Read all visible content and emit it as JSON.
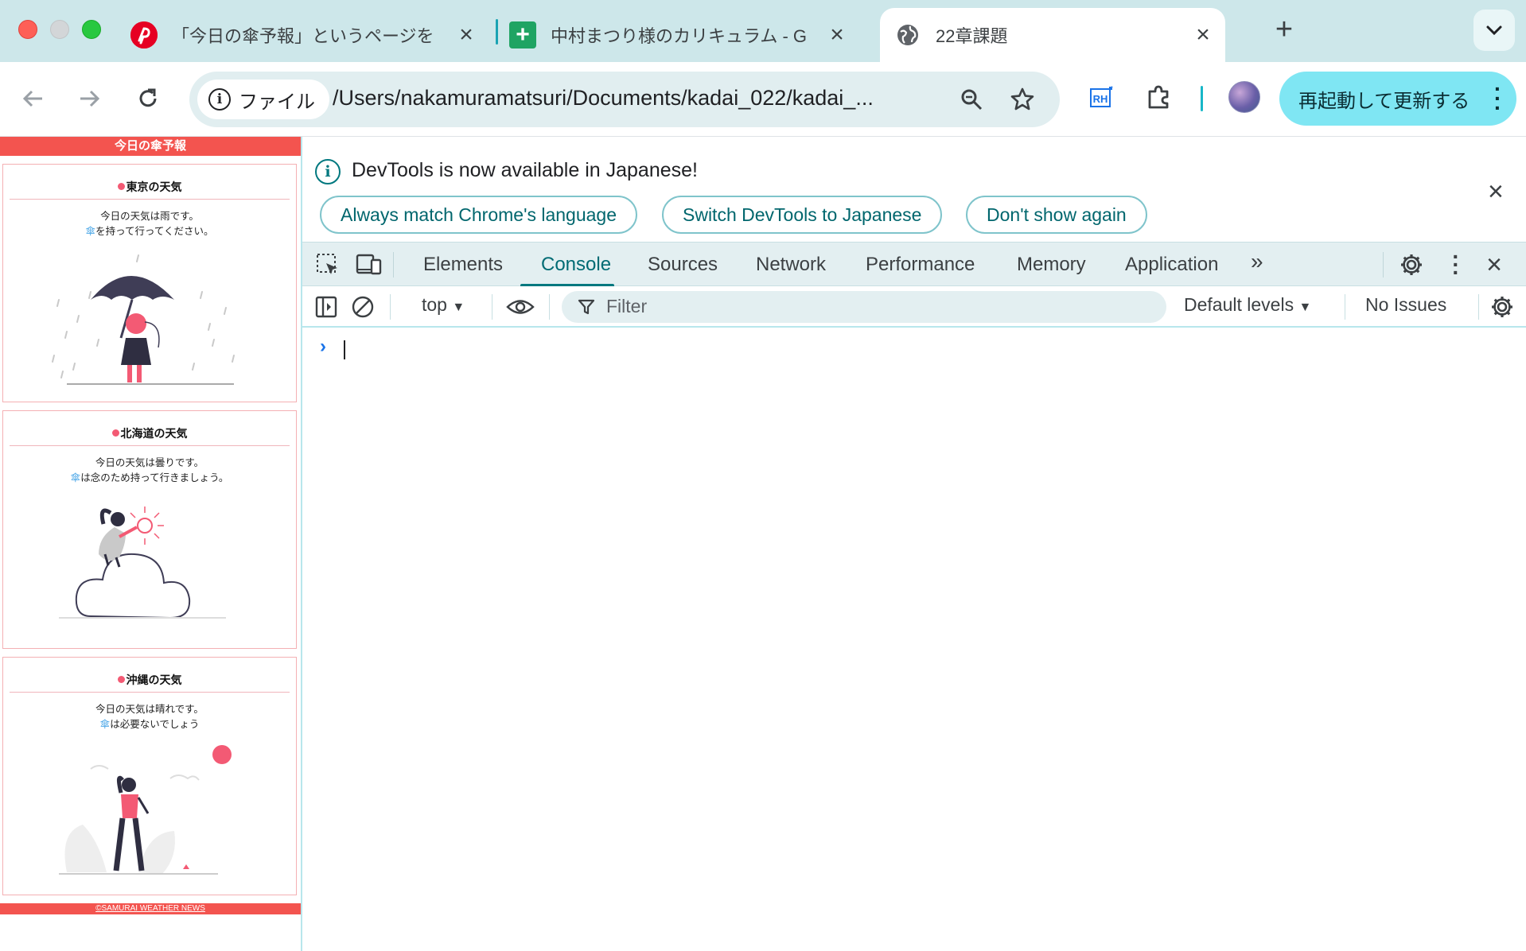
{
  "browser": {
    "tabs": [
      {
        "title": "「今日の傘予報」というページを",
        "favicon": "pinterest-icon",
        "active": false
      },
      {
        "title": "中村まつり様のカリキュラム - G",
        "favicon": "google-sheets-icon",
        "active": false
      },
      {
        "title": "22章課題",
        "favicon": "globe-icon",
        "active": true
      }
    ],
    "new_tab_symbol": "+",
    "site_chip": "ファイル",
    "url": "/Users/nakamuramatsuri/Documents/kadai_022/kadai_...",
    "extension_rh": "RH",
    "relaunch_label": "再起動して更新する"
  },
  "page": {
    "header": "今日の傘予報",
    "cards": [
      {
        "title": "東京の天気",
        "line1": "今日の天気は雨です。",
        "umbrella": "傘",
        "line2": "を持って行ってください。"
      },
      {
        "title": "北海道の天気",
        "line1": "今日の天気は曇りです。",
        "umbrella": "傘",
        "line2": "は念のため持って行きましょう。"
      },
      {
        "title": "沖縄の天気",
        "line1": "今日の天気は晴れです。",
        "umbrella": "傘",
        "line2": "は必要ないでしょう"
      }
    ],
    "footer": "©SAMURAI WEATHER NEWS"
  },
  "devtools": {
    "infobar": {
      "message": "DevTools is now available in Japanese!",
      "buttons": [
        "Always match Chrome's language",
        "Switch DevTools to Japanese",
        "Don't show again"
      ]
    },
    "tabs": [
      "Elements",
      "Console",
      "Sources",
      "Network",
      "Performance",
      "Memory",
      "Application"
    ],
    "active_tab": "Console",
    "more_tabs": "»",
    "console": {
      "context": "top",
      "filter_placeholder": "Filter",
      "levels": "Default levels",
      "issues": "No Issues",
      "prompt": "›"
    }
  },
  "colors": {
    "tabstrip": "#cde7ea",
    "accent": "#00787f",
    "site_red": "#f3544f",
    "relaunch": "#7fe6f3"
  }
}
